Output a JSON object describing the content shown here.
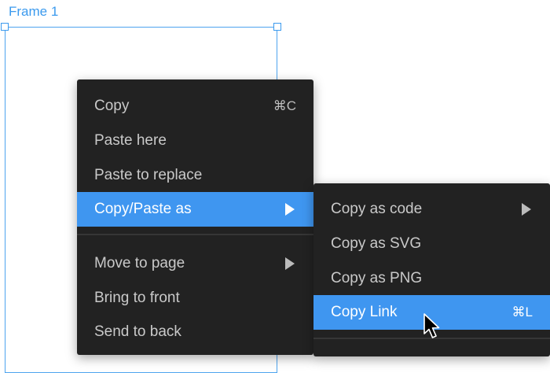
{
  "canvas": {
    "frame_label": "Frame 1"
  },
  "context_menu": {
    "items": [
      {
        "label": "Copy",
        "shortcut": "⌘C"
      },
      {
        "label": "Paste here"
      },
      {
        "label": "Paste to replace"
      },
      {
        "label": "Copy/Paste as",
        "submenu": true,
        "active": true
      },
      {
        "label": "Move to page",
        "submenu": true
      },
      {
        "label": "Bring to front"
      },
      {
        "label": "Send to back"
      }
    ]
  },
  "submenu": {
    "items": [
      {
        "label": "Copy as code",
        "submenu": true
      },
      {
        "label": "Copy as SVG"
      },
      {
        "label": "Copy as PNG"
      },
      {
        "label": "Copy Link",
        "shortcut": "⌘L",
        "active": true
      }
    ]
  },
  "colors": {
    "accent": "#3f96f0",
    "menu_bg": "#222222",
    "frame_outline": "#4ea4ef"
  },
  "icons": {
    "submenu_arrow": "chevron-right-icon",
    "pointer": "mouse-pointer-icon"
  }
}
